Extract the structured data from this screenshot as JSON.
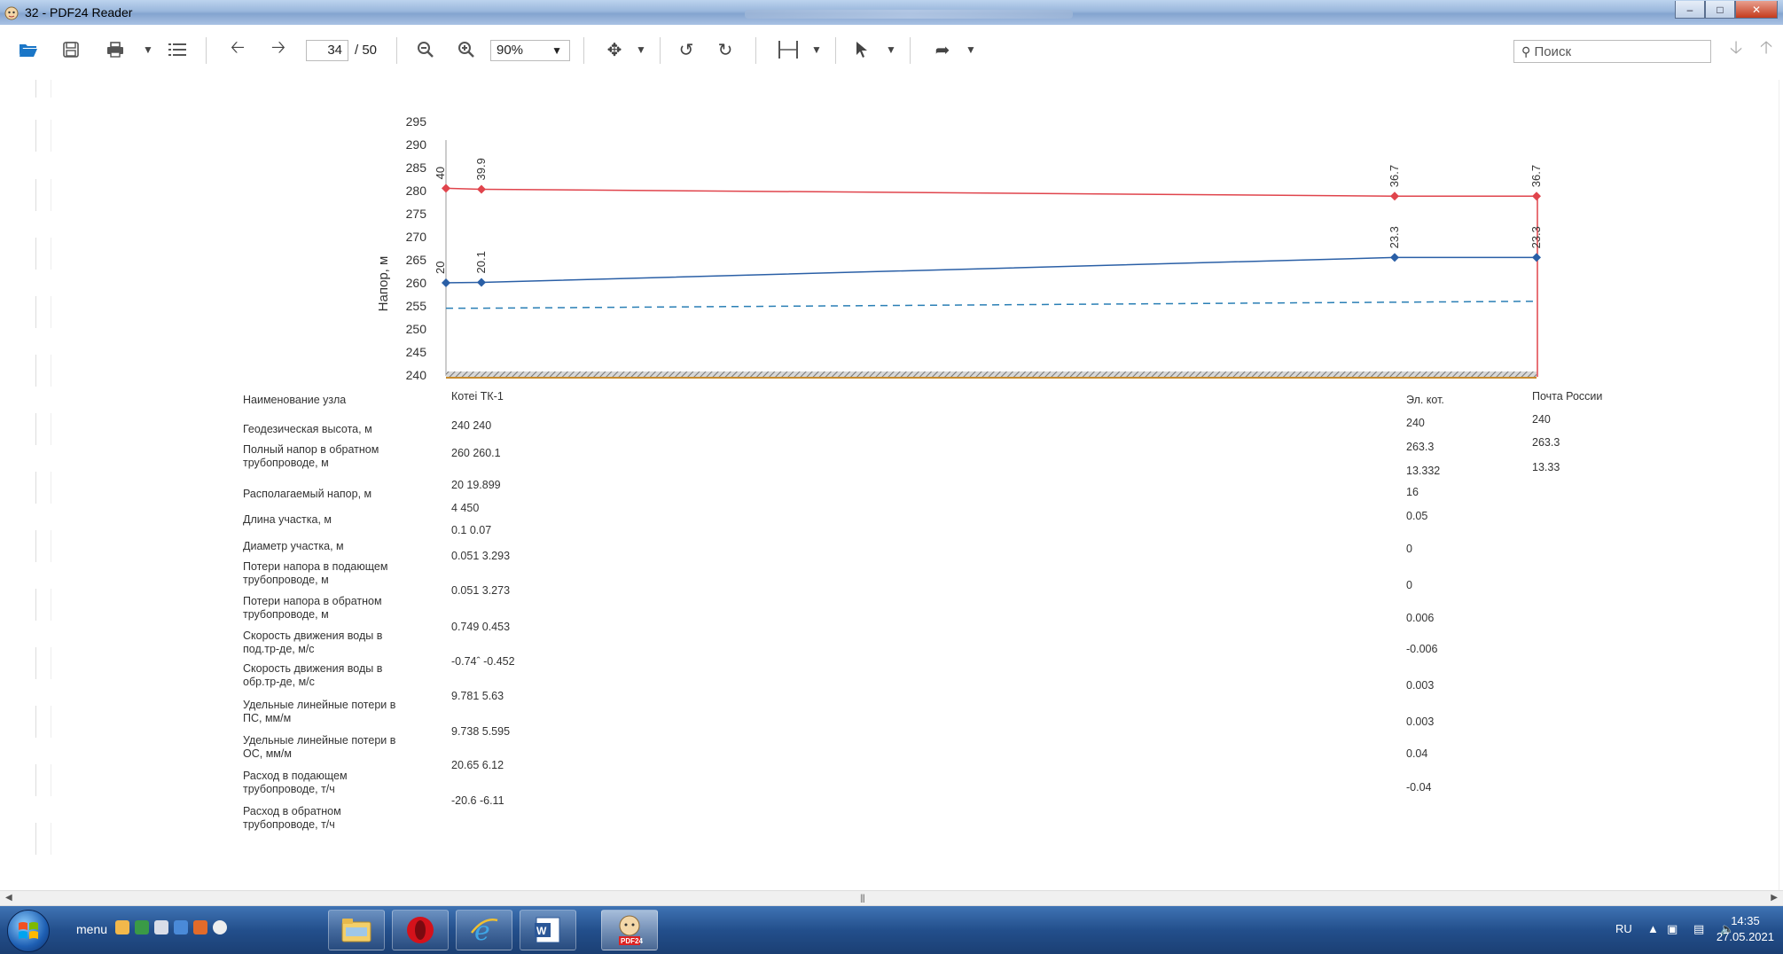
{
  "window": {
    "title": "32 - PDF24 Reader"
  },
  "toolbar": {
    "page_current": "34",
    "page_total": "/ 50",
    "zoom": "90%",
    "search_placeholder": "Поиск"
  },
  "sheet": {
    "row_labels": [
      [
        "Наименование узла"
      ],
      [
        "Геодезическая высота, м"
      ],
      [
        "Полный напор в обратном",
        "трубопроводе, м"
      ],
      [
        "Располагаемый напор, м"
      ],
      [
        "Длина участка, м"
      ],
      [
        "Диаметр участка, м"
      ],
      [
        "Потери напора в подающем",
        "трубопроводе, м"
      ],
      [
        "Потери напора в обратном",
        "трубопроводе, м"
      ],
      [
        "Скорость движения воды в",
        "под.тр-де, м/с"
      ],
      [
        "Скорость движения воды в",
        "обр.тр-де, м/с"
      ],
      [
        "Удельные линейные потери в",
        "ПС, мм/м"
      ],
      [
        "Удельные линейные потери в",
        "ОС, мм/м"
      ],
      [
        "Расход в подающем",
        "трубопроводе, т/ч"
      ],
      [
        "Расход в обратном",
        "трубопроводе, т/ч"
      ]
    ],
    "col_kotel": [
      "Котеі ТК-1",
      "240  240",
      "260  260.1",
      "20    19.899",
      "4      450",
      "0.1   0.07",
      "0.051 3.293",
      "0.051 3.273",
      "0.749 0.453",
      "-0.74ˆ -0.452",
      "9.781 5.63",
      "9.738 5.595",
      "20.65 6.12",
      "-20.6  -6.11"
    ],
    "col_el": [
      "Эл. кот.",
      "240",
      "263.3",
      "13.332",
      "16",
      "0.05",
      "0",
      "0",
      "0.006",
      "-0.006",
      "0.003",
      "0.003",
      "0.04",
      "-0.04"
    ],
    "col_pochta": [
      "Почта России",
      "240",
      "263.3",
      "13.33"
    ]
  },
  "chart_data": {
    "type": "line",
    "ylabel": "Напор, м",
    "ylim": [
      240,
      295
    ],
    "yticks": [
      295,
      290,
      285,
      280,
      275,
      270,
      265,
      260,
      255,
      250,
      245,
      240
    ],
    "nodes": [
      "Котел",
      "ТК-1",
      "Эл. кот.",
      "Почта России"
    ],
    "x_distance": [
      0,
      4,
      454,
      470
    ],
    "series": [
      {
        "color": "#e0444c",
        "values": [
          280.5,
          280.3,
          278.8,
          278.8
        ],
        "labels": [
          "40",
          "39.9",
          "36.7",
          "36.7"
        ]
      },
      {
        "color": "#2a5fa6",
        "values": [
          260,
          260.1,
          265.5,
          265.5
        ],
        "labels": [
          "20",
          "20.1",
          "23.3",
          "23.3"
        ]
      },
      {
        "color": "#2a7fb5",
        "style": "dashed",
        "values": [
          254.5,
          254.5,
          255.8,
          256
        ]
      }
    ]
  },
  "taskbar": {
    "menu_label": "menu",
    "lang": "RU",
    "time": "14:35",
    "date": "27.05.2021"
  },
  "colors": {
    "supply": "#e0444c",
    "return": "#2a5fa6",
    "terrain": "#c78a2c"
  }
}
